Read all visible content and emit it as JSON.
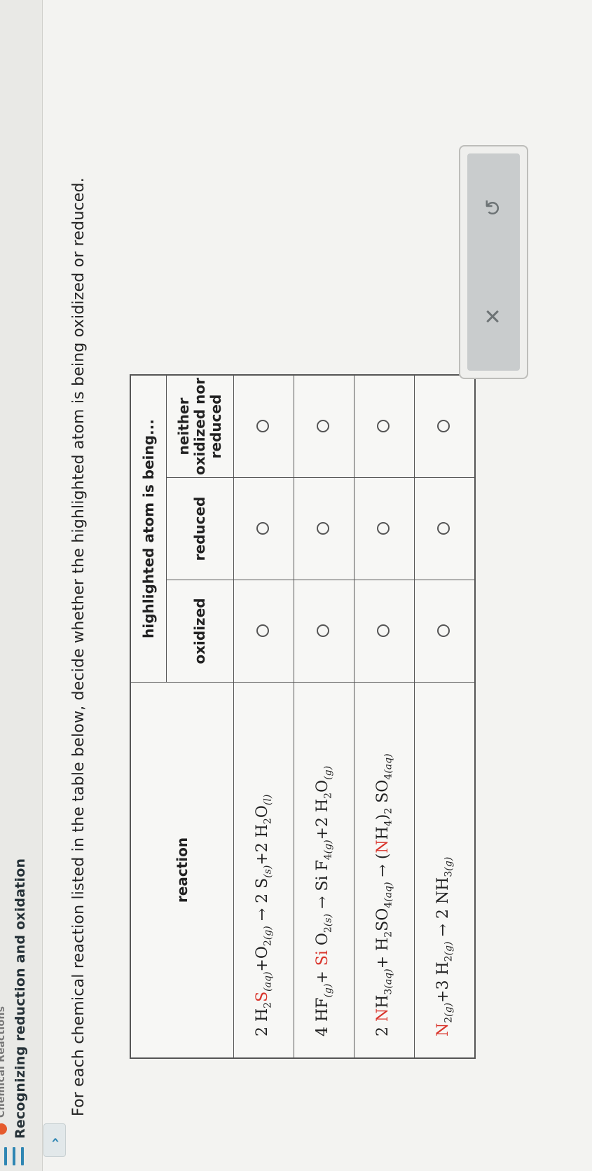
{
  "header": {
    "breadcrumb": "Chemical Reactions",
    "title": "Recognizing reduction and oxidation"
  },
  "toggle_icon": "chevron-right-icon",
  "instructions": "For each chemical reaction listed in the table below, decide whether the highlighted atom is being oxidized or reduced.",
  "table": {
    "reaction_header": "reaction",
    "group_header": "highlighted atom is being...",
    "col_oxidized": "oxidized",
    "col_reduced": "reduced",
    "col_neither_1": "neither",
    "col_neither_2": "oxidized nor",
    "col_neither_3": "reduced",
    "rows": [
      {
        "parts": [
          "2 H",
          "2",
          "S",
          "(aq)",
          "+O",
          "2",
          "(g)",
          " → 2 ",
          "S",
          "(s)",
          "+2 H",
          "2",
          "O",
          "(l)"
        ]
      },
      {
        "parts": [
          "4 HF",
          "(g)",
          "+ ",
          "Si",
          " O",
          "2",
          "(s)",
          " → ",
          "Si",
          " F",
          "4",
          "(g)",
          "+2 H",
          "2",
          "O",
          "(g)"
        ]
      },
      {
        "parts": [
          "2 ",
          "N",
          "H",
          "3",
          "(aq)",
          "+ H",
          "2",
          "SO",
          "4",
          "(aq)",
          " → (",
          "N",
          "H",
          "4",
          ")",
          "2",
          " SO",
          "4",
          "(aq)"
        ]
      },
      {
        "parts": [
          "N",
          "2",
          "(g)",
          "+3 H",
          "2",
          "(g)",
          " → 2 ",
          "N",
          "H",
          "3",
          "(g)"
        ]
      }
    ]
  },
  "actions": {
    "clear_label": "✕",
    "undo_label": "↺"
  },
  "colors": {
    "highlight": "#d9342b",
    "accent": "#2f86b3"
  }
}
